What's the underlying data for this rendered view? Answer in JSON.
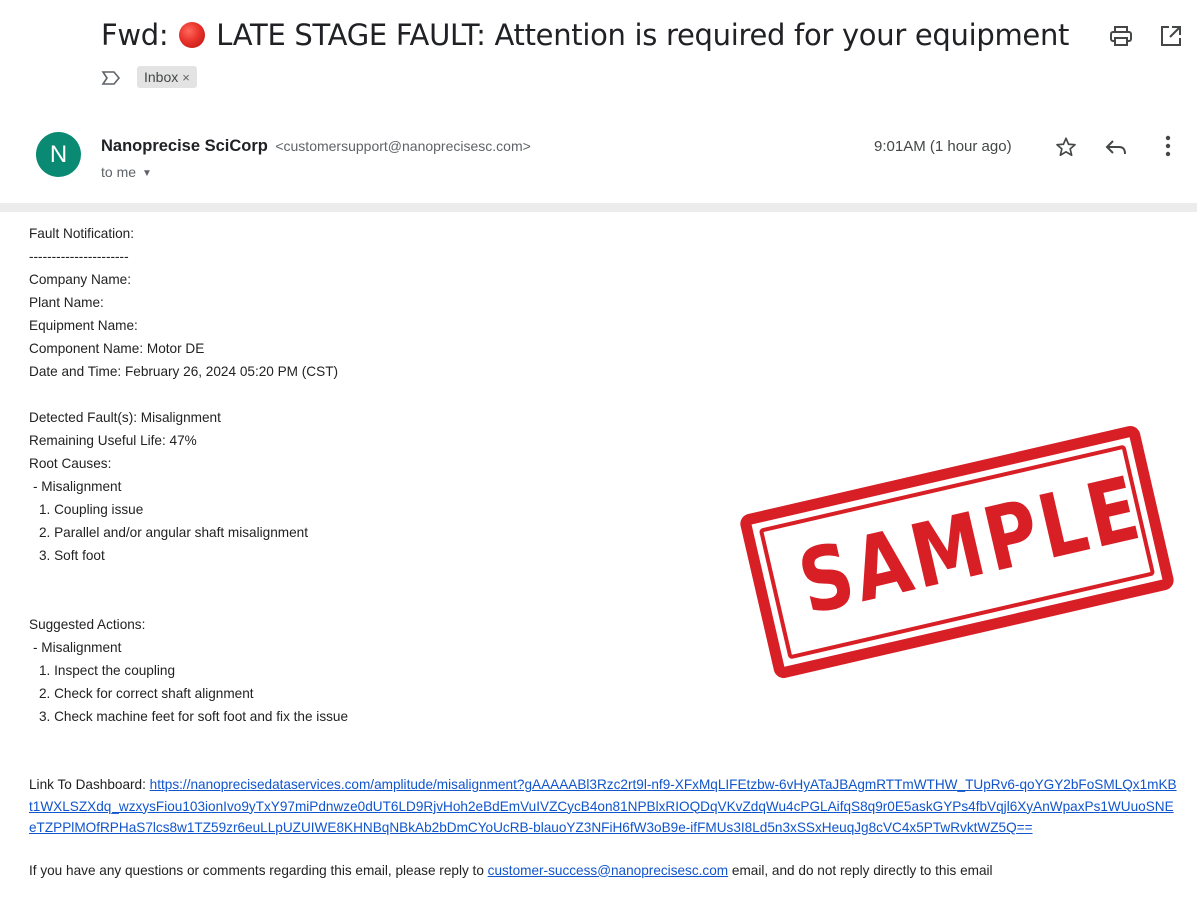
{
  "header": {
    "subject_prefix": "Fwd:",
    "subject_text": "LATE STAGE FAULT: Attention is required for your equipment",
    "label": "Inbox",
    "label_remove": "×"
  },
  "sender": {
    "initial": "N",
    "name": "Nanoprecise SciCorp",
    "email": "<customersupport@nanoprecisesc.com>",
    "recipient": "to me",
    "timestamp": "9:01AM (1 hour ago)"
  },
  "icons": {
    "subject_badge": "red-circle-icon",
    "print": "print-icon",
    "popout": "open-in-new-window-icon",
    "important": "important-marker-icon",
    "star": "star-icon",
    "reply": "reply-icon",
    "more": "more-vertical-icon",
    "recipient_dropdown": "chevron-down-icon"
  },
  "colors": {
    "avatar": "#0b8a73",
    "link": "#1155cc",
    "stamp": "#d81f26"
  },
  "body": {
    "heading": "Fault Notification:",
    "divider": "----------------------",
    "company": "Company Name:",
    "plant": "Plant Name:",
    "equipment": "Equipment Name:",
    "component": "Component Name: Motor DE",
    "datetime": "Date and Time: February 26, 2024 05:20 PM (CST)",
    "fault": "Detected Fault(s): Misalignment",
    "rul": "Remaining Useful Life: 47%",
    "root_heading": "Root Causes:",
    "root_group": "- Misalignment",
    "root_causes": [
      "1. Coupling issue",
      "2. Parallel and/or angular shaft misalignment",
      "3. Soft foot"
    ],
    "actions_heading": "Suggested Actions:",
    "actions_group": "- Misalignment",
    "actions": [
      "1. Inspect the coupling",
      "2. Check for correct shaft alignment",
      "3. Check machine feet for soft foot and fix the issue"
    ],
    "dashboard_label": "Link To Dashboard:",
    "dashboard_url": "https://nanoprecisedataservices.com/amplitude/misalignment?gAAAAABl3Rzc2rt9l-nf9-XFxMqLIFEtzbw-6vHyATaJBAgmRTTmWTHW_TUpRv6-qoYGY2bFoSMLQx1mKBt1WXLSZXdq_wzxysFiou103ionIvo9yTxY97miPdnwze0dUT6LD9RjvHoh2eBdEmVuIVZCycB4on81NPBlxRIOQDqVKvZdqWu4cPGLAifqS8q9r0E5askGYPs4fbVqjl6XyAnWpaxPs1WUuoSNEeTZPPlMOfRPHaS7lcs8w1TZ59zr6euLLpUZUIWE8KHNBqNBkAb2bDmCYoUcRB-blauoYZ3NFiH6fW3oB9e-ifFMUs3I8Ld5n3xSSxHeuqJg8cVC4x5PTwRvktWZ5Q==",
    "footer_before": "If you have any questions or comments regarding this email, please reply to",
    "footer_email": "customer-success@nanoprecisesc.com",
    "footer_after": "email, and do not reply directly to this email"
  },
  "stamp": {
    "text": "SAMPLE"
  }
}
